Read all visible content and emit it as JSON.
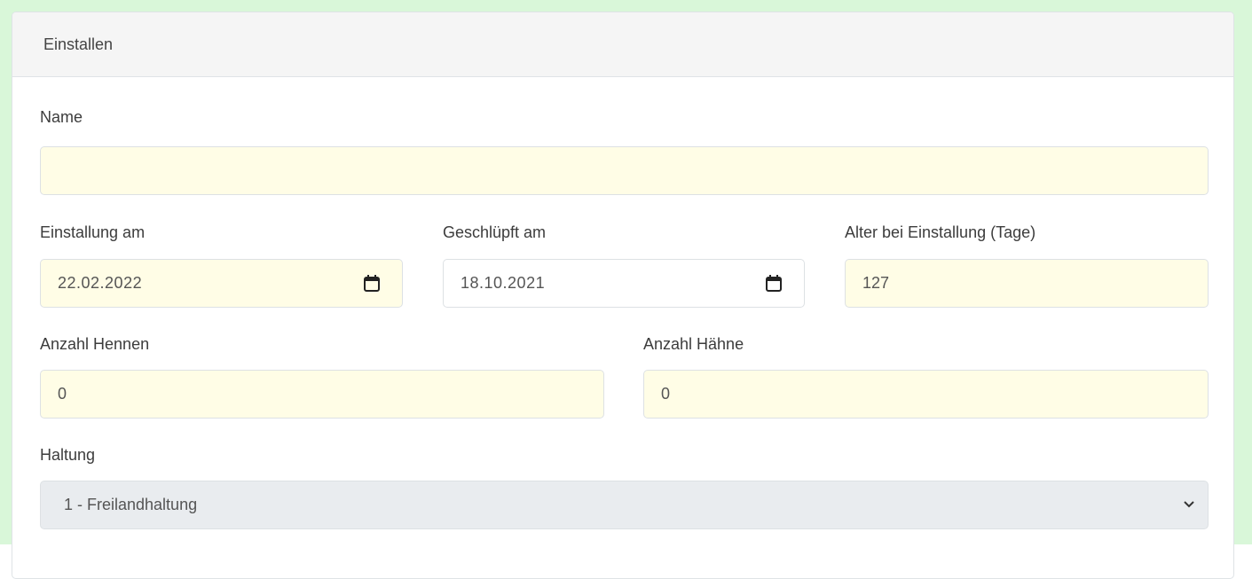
{
  "card": {
    "title": "Einstallen"
  },
  "form": {
    "name": {
      "label": "Name",
      "value": ""
    },
    "einstallung": {
      "label": "Einstallung am",
      "value": "22.02.2022"
    },
    "geschluepft": {
      "label": "Geschlüpft am",
      "value": "18.10.2021"
    },
    "alter": {
      "label": "Alter bei Einstallung (Tage)",
      "value": "127"
    },
    "hennen": {
      "label": "Anzahl Hennen",
      "value": "0"
    },
    "haehne": {
      "label": "Anzahl Hähne",
      "value": "0"
    },
    "haltung": {
      "label": "Haltung",
      "selected": "1 - Freilandhaltung"
    }
  },
  "icons": {
    "date_picker": "calendar-icon",
    "select_arrow": "chevron-down-icon"
  },
  "colors": {
    "frame": "#d9f7d9",
    "field_highlight": "#fffde6",
    "field_disabled": "#e9ecef",
    "header_bg": "#f5f5f5"
  }
}
